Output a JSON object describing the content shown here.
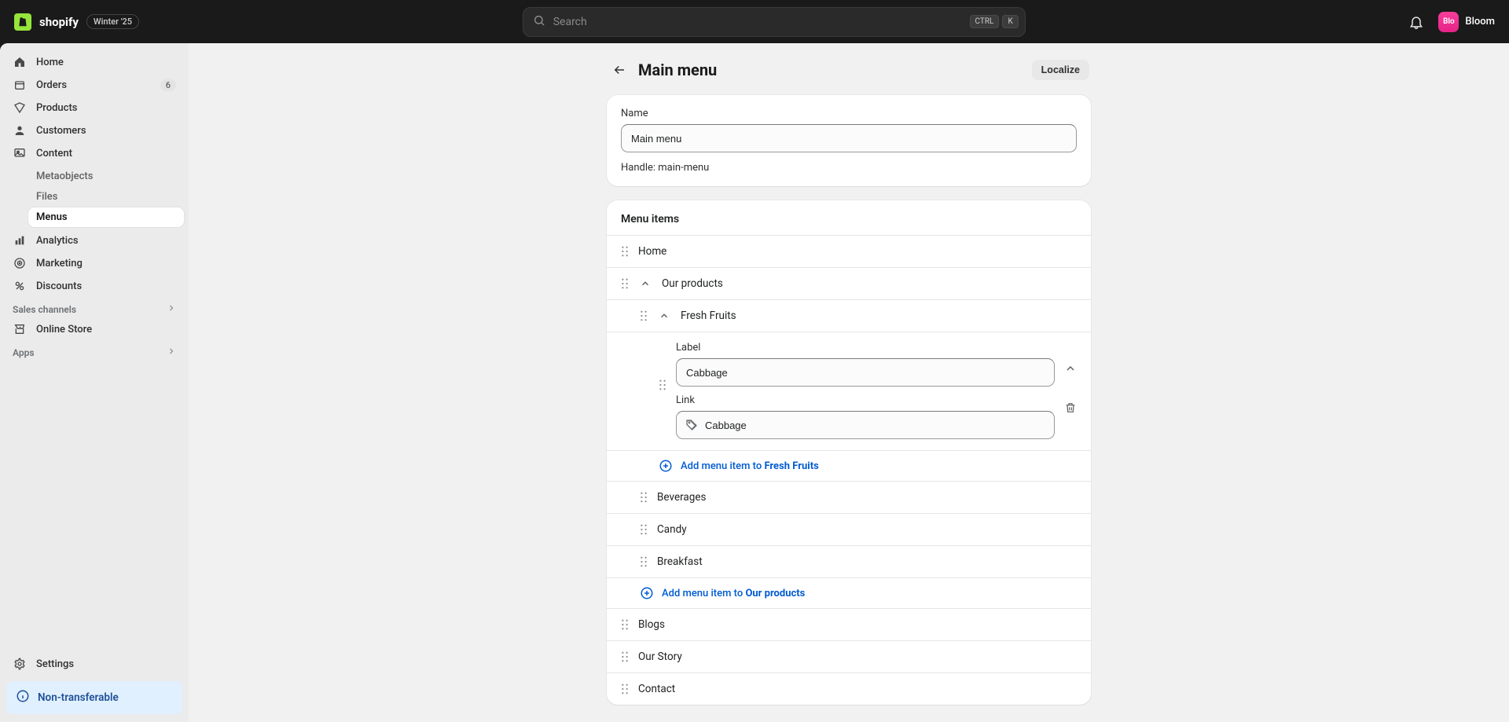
{
  "topbar": {
    "brand": "shopify",
    "tag": "Winter '25",
    "search_placeholder": "Search",
    "kbd_ctrl": "CTRL",
    "kbd_k": "K",
    "store_initials": "Blo",
    "store_name": "Bloom"
  },
  "sidebar": {
    "items": {
      "home": "Home",
      "orders": "Orders",
      "orders_badge": "6",
      "products": "Products",
      "customers": "Customers",
      "content": "Content",
      "analytics": "Analytics",
      "marketing": "Marketing",
      "discounts": "Discounts"
    },
    "content_sub": {
      "metaobjects": "Metaobjects",
      "files": "Files",
      "menus": "Menus"
    },
    "sales_channels_heading": "Sales channels",
    "online_store": "Online Store",
    "apps_heading": "Apps",
    "settings": "Settings",
    "non_transferable": "Non-transferable"
  },
  "page": {
    "title": "Main menu",
    "localize": "Localize",
    "name_label": "Name",
    "name_value": "Main menu",
    "handle_text": "Handle: main-menu"
  },
  "menu": {
    "section_title": "Menu items",
    "items": {
      "home": "Home",
      "our_products": "Our products",
      "fresh_fruits": "Fresh Fruits",
      "beverages": "Beverages",
      "candy": "Candy",
      "breakfast": "Breakfast",
      "blogs": "Blogs",
      "our_story": "Our Story",
      "contact": "Contact"
    },
    "edit": {
      "label_label": "Label",
      "label_value": "Cabbage",
      "link_label": "Link",
      "link_value": "Cabbage"
    },
    "add_fresh_prefix": "Add menu item to ",
    "add_fresh_target": "Fresh Fruits",
    "add_products_prefix": "Add menu item to ",
    "add_products_target": "Our products"
  }
}
